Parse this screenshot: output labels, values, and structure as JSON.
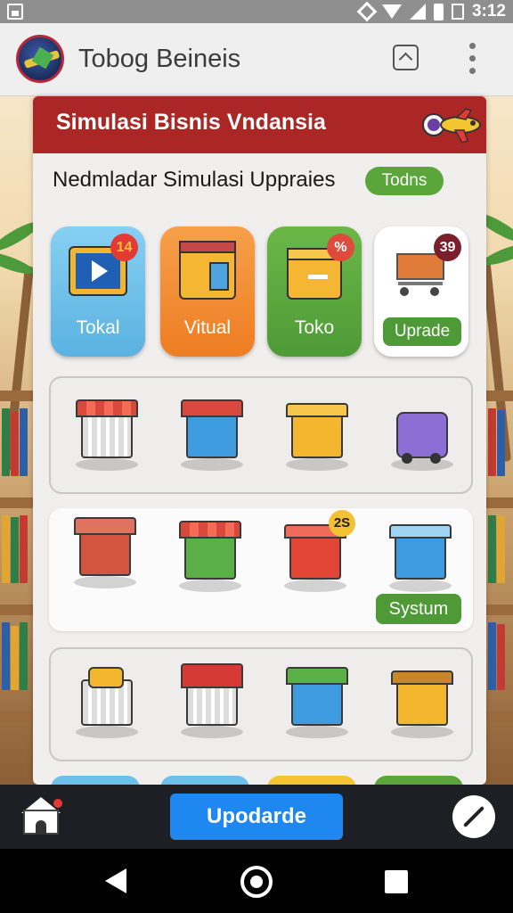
{
  "status_bar": {
    "time": "3:12",
    "icons": [
      "gallery-icon",
      "nfc-icon",
      "wifi-icon",
      "signal-icon",
      "battery-icon",
      "sim-icon"
    ]
  },
  "app_bar": {
    "title": "Tobog Beineis",
    "logo_icon": "globe-plane-logo",
    "actions": [
      "collapse-icon",
      "more-vert-icon"
    ]
  },
  "banner": {
    "title": "Simulasi Bisnis Vndansia",
    "icon": "airplane-icon",
    "color": "#aa2725"
  },
  "section": {
    "title": "Nedmladar Simulasi Uppraies",
    "badge": "Todns"
  },
  "cards": [
    {
      "label": "Tokal",
      "badge": "14",
      "icon": "video-board-icon",
      "color": "#6cc0ea"
    },
    {
      "label": "Vitual",
      "icon": "store-box-icon",
      "color": "#f08a2e"
    },
    {
      "label": "Toko",
      "badge": "%",
      "icon": "box-icon",
      "color": "#5aa63b"
    },
    {
      "label": "",
      "badge": "39",
      "button": "Uprade",
      "icon": "shopping-cart-icon",
      "color": "#ffffff"
    }
  ],
  "grid_rows": [
    {
      "items": [
        {
          "icon": "shop-cart-icon"
        },
        {
          "icon": "blue-house-icon"
        },
        {
          "icon": "yellow-box-icon"
        },
        {
          "icon": "delivery-truck-icon"
        }
      ]
    },
    {
      "items": [
        {
          "icon": "red-kiosk-icon"
        },
        {
          "icon": "market-stall-icon"
        },
        {
          "icon": "red-box-icon",
          "badge": "2S"
        },
        {
          "icon": "blue-cube-icon"
        }
      ],
      "button": "Systum"
    },
    {
      "items": [
        {
          "icon": "cart-with-bin-icon"
        },
        {
          "icon": "loaded-cart-icon"
        },
        {
          "icon": "green-roof-shop-icon"
        },
        {
          "icon": "open-box-icon"
        }
      ]
    }
  ],
  "bottom_bar": {
    "home_icon": "home-icon",
    "update_label": "Upodarde",
    "edit_icon": "edit-icon",
    "update_color": "#1e88f0"
  },
  "nav_bar": {
    "icons": [
      "back-icon",
      "home-circle-icon",
      "recents-icon"
    ]
  }
}
